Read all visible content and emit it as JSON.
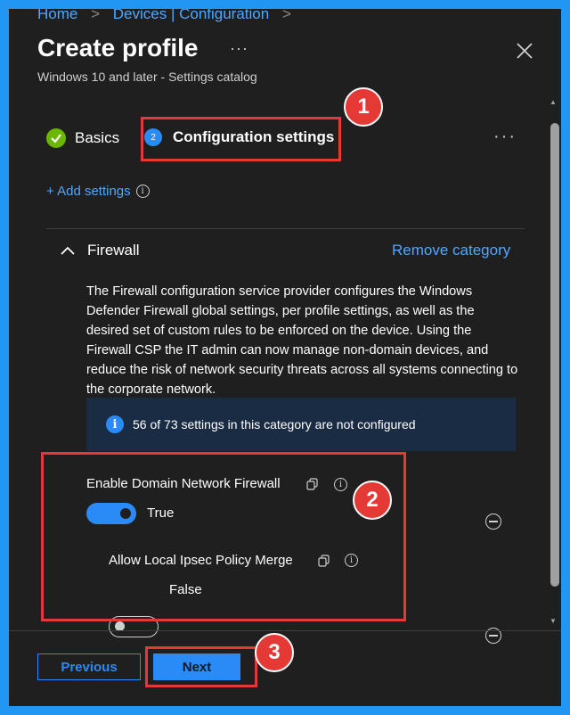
{
  "breadcrumb": {
    "home": "Home",
    "devices": "Devices | Configuration"
  },
  "header": {
    "title": "Create profile",
    "more": "···",
    "subtitle": "Windows 10 and later - Settings catalog"
  },
  "steps": {
    "basics": "Basics",
    "config_number": "2",
    "config": "Configuration settings",
    "more": "···"
  },
  "add_settings": "+ Add settings",
  "category": {
    "title": "Firewall",
    "remove": "Remove category",
    "description": "The Firewall configuration service provider configures the Windows Defender Firewall global settings, per profile settings, as well as the desired set of custom rules to be enforced on the device. Using the Firewall CSP the IT admin can now manage non-domain devices, and reduce the risk of network security threats across all systems connecting to the corporate network.",
    "info": "56 of 73 settings in this category are not configured"
  },
  "settings": [
    {
      "label": "Enable Domain Network Firewall",
      "value": "True",
      "enabled": true
    },
    {
      "label": "Allow Local Ipsec Policy Merge",
      "value": "False",
      "enabled": false
    }
  ],
  "annotations": {
    "one": "1",
    "two": "2",
    "three": "3"
  },
  "footer": {
    "previous": "Previous",
    "next": "Next"
  },
  "colors": {
    "accent": "#2a8af6",
    "annotation": "#e53935",
    "background": "#1f1f1f",
    "frame": "#2196f3"
  }
}
